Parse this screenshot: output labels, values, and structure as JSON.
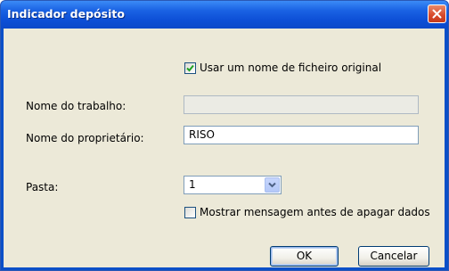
{
  "window": {
    "title": "Indicador depósito",
    "close_icon": "close-icon"
  },
  "form": {
    "use_original_filename": {
      "label": "Usar um nome de ficheiro original",
      "checked": true
    },
    "job_name": {
      "label": "Nome do trabalho:",
      "value": "",
      "enabled": false
    },
    "owner_name": {
      "label": "Nome do proprietário:",
      "value": "RISO"
    },
    "folder": {
      "label": "Pasta:",
      "selected": "1"
    },
    "confirm_delete": {
      "label": "Mostrar mensagem antes de apagar dados",
      "checked": false
    }
  },
  "buttons": {
    "ok": "OK",
    "cancel": "Cancelar"
  },
  "colors": {
    "titlebar": "#0d4fd6",
    "client_bg": "#ece9d8",
    "close_button": "#d8482a"
  }
}
